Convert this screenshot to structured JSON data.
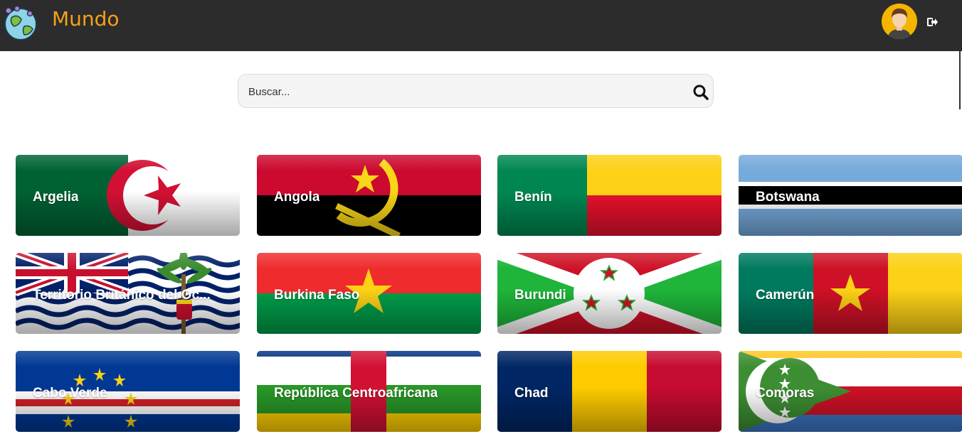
{
  "header": {
    "brand": "Mundo",
    "logo_icon": "globe-icon",
    "avatar_icon": "user-avatar-icon",
    "logout_icon": "logout-icon"
  },
  "search": {
    "placeholder": "Buscar...",
    "value": "",
    "icon": "search-icon"
  },
  "countries": [
    {
      "name": "Argelia"
    },
    {
      "name": "Angola"
    },
    {
      "name": "Benín"
    },
    {
      "name": "Botswana"
    },
    {
      "name": "Territorio Británico del Oc..."
    },
    {
      "name": "Burkina Faso"
    },
    {
      "name": "Burundi"
    },
    {
      "name": "Camerún"
    },
    {
      "name": "Cabo Verde"
    },
    {
      "name": "República Centroafricana"
    },
    {
      "name": "Chad"
    },
    {
      "name": "Comoras"
    }
  ],
  "colors": {
    "topbar": "#2c2c2c",
    "brand": "#f5a01a"
  }
}
